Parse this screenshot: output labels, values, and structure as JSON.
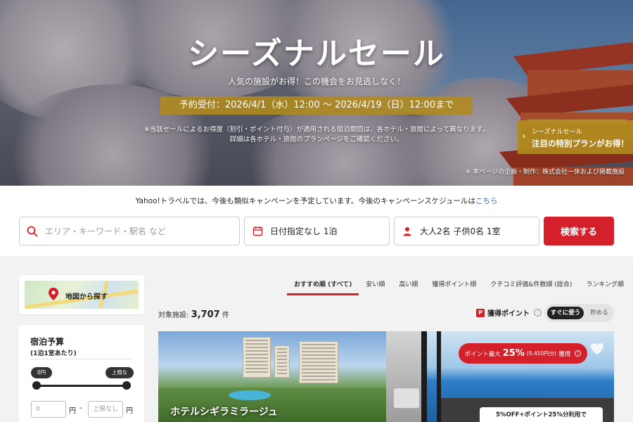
{
  "hero": {
    "title": "シーズナルセール",
    "subtitle": "人気の施設がお得！この機会をお見逃しなく！",
    "period": "予約受付：2026/4/1（水）12:00 〜 2026/4/19（日）12:00まで",
    "note_line1": "※当該セールによるお得度（割引・ポイント付与）が適用される宿泊期間は、各ホテル・旅館によって異なります。",
    "note_line2": "詳細は各ホテル・旅館のプランページをご確認ください。",
    "credit": "※ 本ページの企画・制作：株式会社一休および掲載施設",
    "side_banner": {
      "small": "シーズナルセール",
      "large": "注目の特別プランがお得！"
    }
  },
  "campaign": {
    "text": "Yahoo!トラベルでは、今後も類似キャンペーンを予定しています。今後のキャンペーンスケジュールは",
    "link": "こちら"
  },
  "search": {
    "area_placeholder": "エリア・キーワード・駅名 など",
    "date_value": "日付指定なし 1泊",
    "guest_value": "大人2名 子供0名 1室",
    "button": "検索する"
  },
  "sidebar": {
    "map_label": "地図から探す",
    "budget": {
      "title": "宿泊予算",
      "subtitle": "(1泊1室あたり)",
      "min_tip": "0円",
      "max_tip": "上限なし",
      "min_placeholder": "0",
      "max_placeholder": "上限なし",
      "yen": "円",
      "dash": "-"
    }
  },
  "sort": {
    "tabs": [
      "おすすめ順 (すべて)",
      "安い順",
      "高い順",
      "獲得ポイント順",
      "クチコミ評価&件数順 (総合)",
      "ランキング順"
    ]
  },
  "results": {
    "count_label": "対象施設:",
    "count": "3,707",
    "count_unit": "件",
    "points_label": "獲得ポイント",
    "points_icon": "P",
    "toggle_on": "すぐに使う",
    "toggle_off": "貯める"
  },
  "cards": [
    {
      "name": "ホテルシギラミラージュ"
    },
    {
      "badge_prefix": "ポイント最大",
      "badge_pct": "25%",
      "badge_paren": "(9,450円分)",
      "badge_suffix": "獲得",
      "promo": "5%OFF+ポイント25%分利用で"
    }
  ],
  "colors": {
    "accent": "#d3202a",
    "gold": "#b08a1e",
    "link": "#2a6ad6"
  }
}
